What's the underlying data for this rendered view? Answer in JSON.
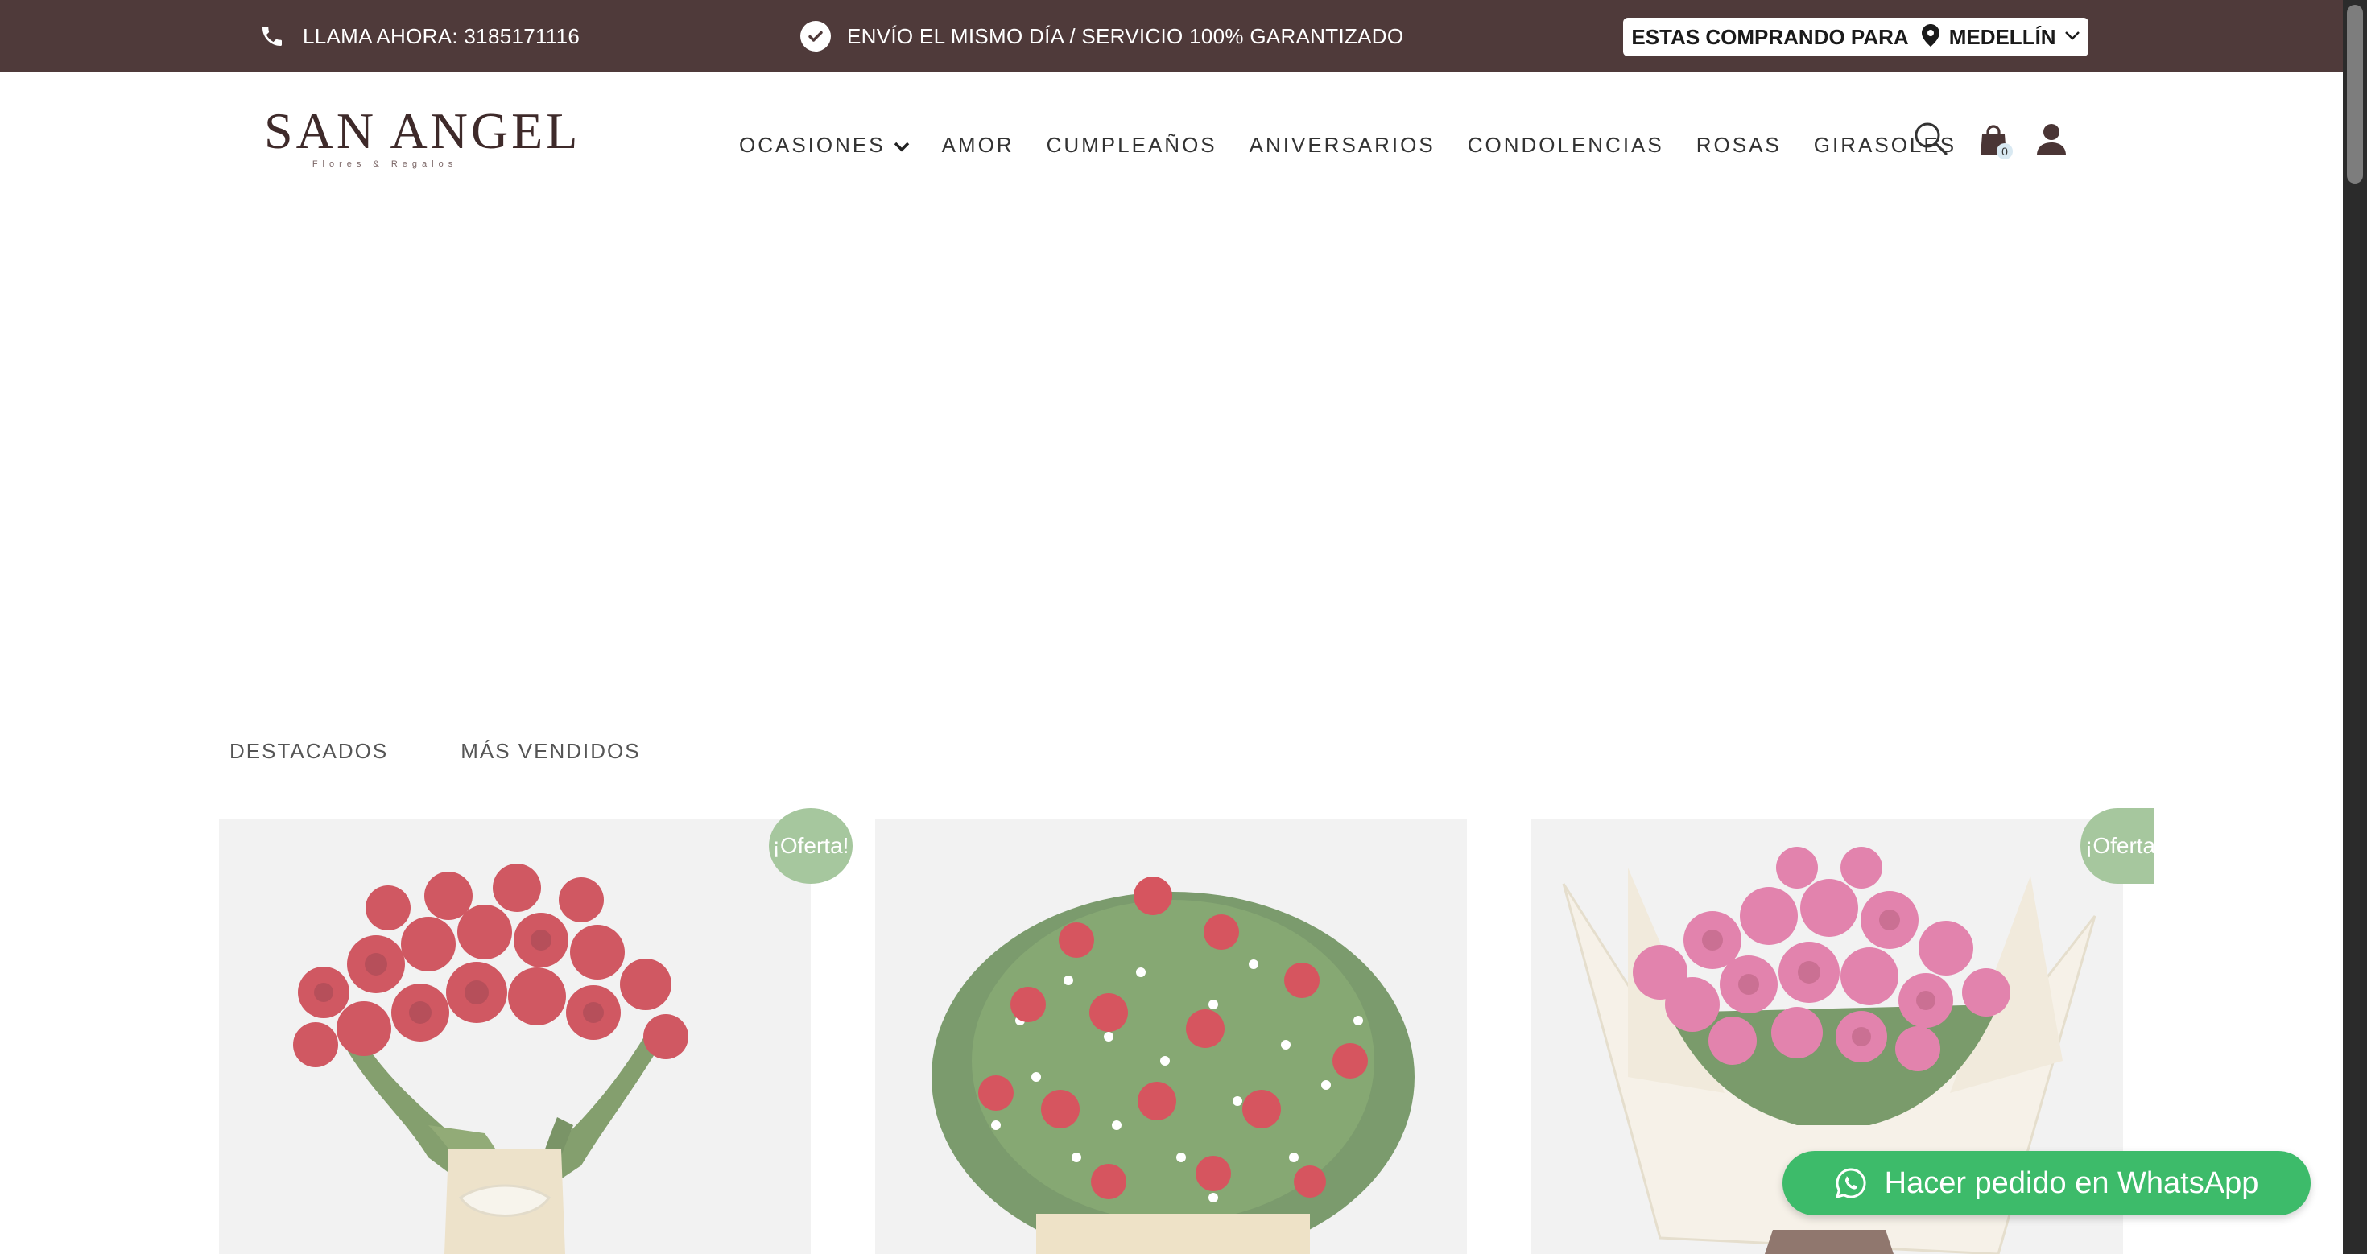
{
  "topbar": {
    "phone_text": "LLAMA AHORA: 3185171116",
    "shipping_text": "ENVÍO EL MISMO DÍA / SERVICIO 100% GARANTIZADO",
    "city_label": "ESTAS COMPRANDO PARA",
    "city_value": "MEDELLÍN"
  },
  "logo": {
    "title": "SAN ANGEL",
    "subtitle": "Flores & Regalos"
  },
  "nav": {
    "items": [
      {
        "label": "OCASIONES"
      },
      {
        "label": "AMOR"
      },
      {
        "label": "CUMPLEAÑOS"
      },
      {
        "label": "ANIVERSARIOS"
      },
      {
        "label": "CONDOLENCIAS"
      },
      {
        "label": "ROSAS"
      },
      {
        "label": "GIRASOLES"
      }
    ],
    "cart_count": "0"
  },
  "tabs": [
    {
      "label": "DESTACADOS"
    },
    {
      "label": "MÁS VENDIDOS"
    }
  ],
  "products": [
    {
      "badge": "¡Oferta!",
      "image": "red-roses-vase"
    },
    {
      "badge": "",
      "image": "red-roses-babys-breath-arrangement"
    },
    {
      "badge": "¡Oferta!",
      "image": "pink-roses-bouquet"
    }
  ],
  "whatsapp": {
    "label": "Hacer pedido en WhatsApp"
  },
  "colors": {
    "topbar_bg": "#4f3a3a",
    "badge_bg": "#a6c79e",
    "whatsapp_bg": "#3dbb6a"
  },
  "icons": [
    "phone-icon",
    "check-circle-icon",
    "location-pin-icon",
    "chevron-down-icon",
    "search-icon",
    "shopping-bag-icon",
    "user-icon",
    "whatsapp-icon"
  ]
}
